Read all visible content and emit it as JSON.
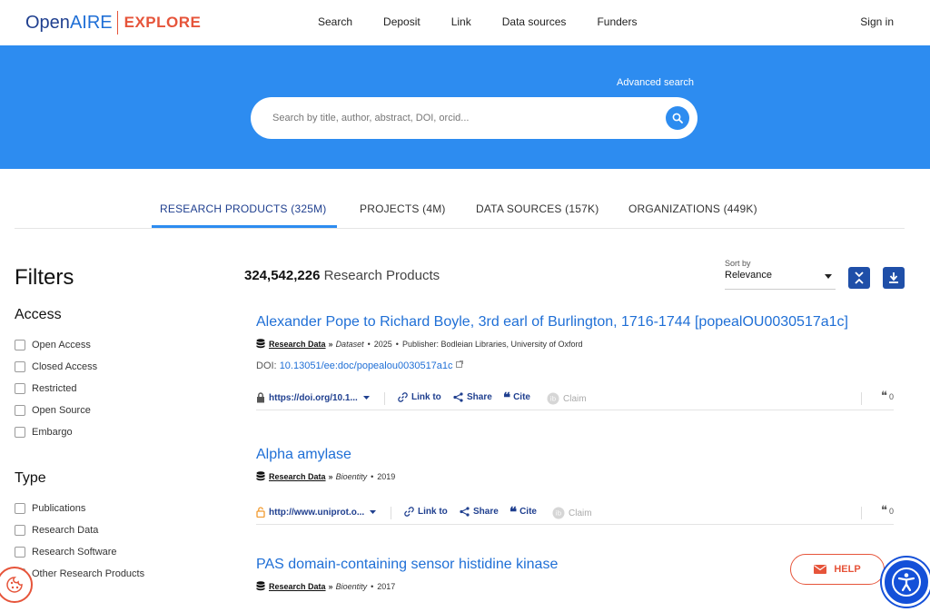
{
  "header": {
    "logo_open": "Open",
    "logo_aire": "AIRE",
    "logo_explore": "EXPLORE",
    "nav": [
      "Search",
      "Deposit",
      "Link",
      "Data sources",
      "Funders"
    ],
    "sign_in": "Sign in"
  },
  "hero": {
    "advanced_search": "Advanced search",
    "search_placeholder": "Search by title, author, abstract, DOI, orcid..."
  },
  "tabs": [
    {
      "label": "RESEARCH PRODUCTS (325M)",
      "active": true
    },
    {
      "label": "PROJECTS (4M)",
      "active": false
    },
    {
      "label": "DATA SOURCES (157K)",
      "active": false
    },
    {
      "label": "ORGANIZATIONS (449K)",
      "active": false
    }
  ],
  "filters": {
    "title": "Filters",
    "access": {
      "title": "Access",
      "items": [
        "Open Access",
        "Closed Access",
        "Restricted",
        "Open Source",
        "Embargo"
      ]
    },
    "type": {
      "title": "Type",
      "items": [
        "Publications",
        "Research Data",
        "Research Software",
        "Other Research Products"
      ]
    }
  },
  "results_header": {
    "count": "324,542,226",
    "count_label": "Research Products",
    "sort_label": "Sort by",
    "sort_value": "Relevance"
  },
  "results": [
    {
      "title": "Alexander Pope to Richard Boyle, 3rd earl of Burlington, 1716-1744 [popealOU0030517a1c]",
      "result_type": "Research Data",
      "subtype": "Dataset",
      "year": "2025",
      "publisher": "Publisher: Bodleian Libraries, University of Oxford",
      "doi_label": "DOI:",
      "doi": "10.13051/ee:doc/popealou0030517a1c",
      "url": "https://doi.org/10.1...",
      "link_to": "Link to",
      "share": "Share",
      "cite": "Cite",
      "claim": "Claim",
      "citations": "0"
    },
    {
      "title": "Alpha amylase",
      "result_type": "Research Data",
      "subtype": "Bioentity",
      "year": "2019",
      "url": "http://www.uniprot.o...",
      "link_to": "Link to",
      "share": "Share",
      "cite": "Cite",
      "claim": "Claim",
      "citations": "0"
    },
    {
      "title": "PAS domain-containing sensor histidine kinase",
      "result_type": "Research Data",
      "subtype": "Bioentity",
      "year": "2017"
    }
  ],
  "floating": {
    "help": "HELP"
  },
  "colors": {
    "brand_blue": "#2d8cf0",
    "navy": "#1f3f8f",
    "accent_orange": "#e6543a",
    "link_blue": "#1f6fd6"
  }
}
